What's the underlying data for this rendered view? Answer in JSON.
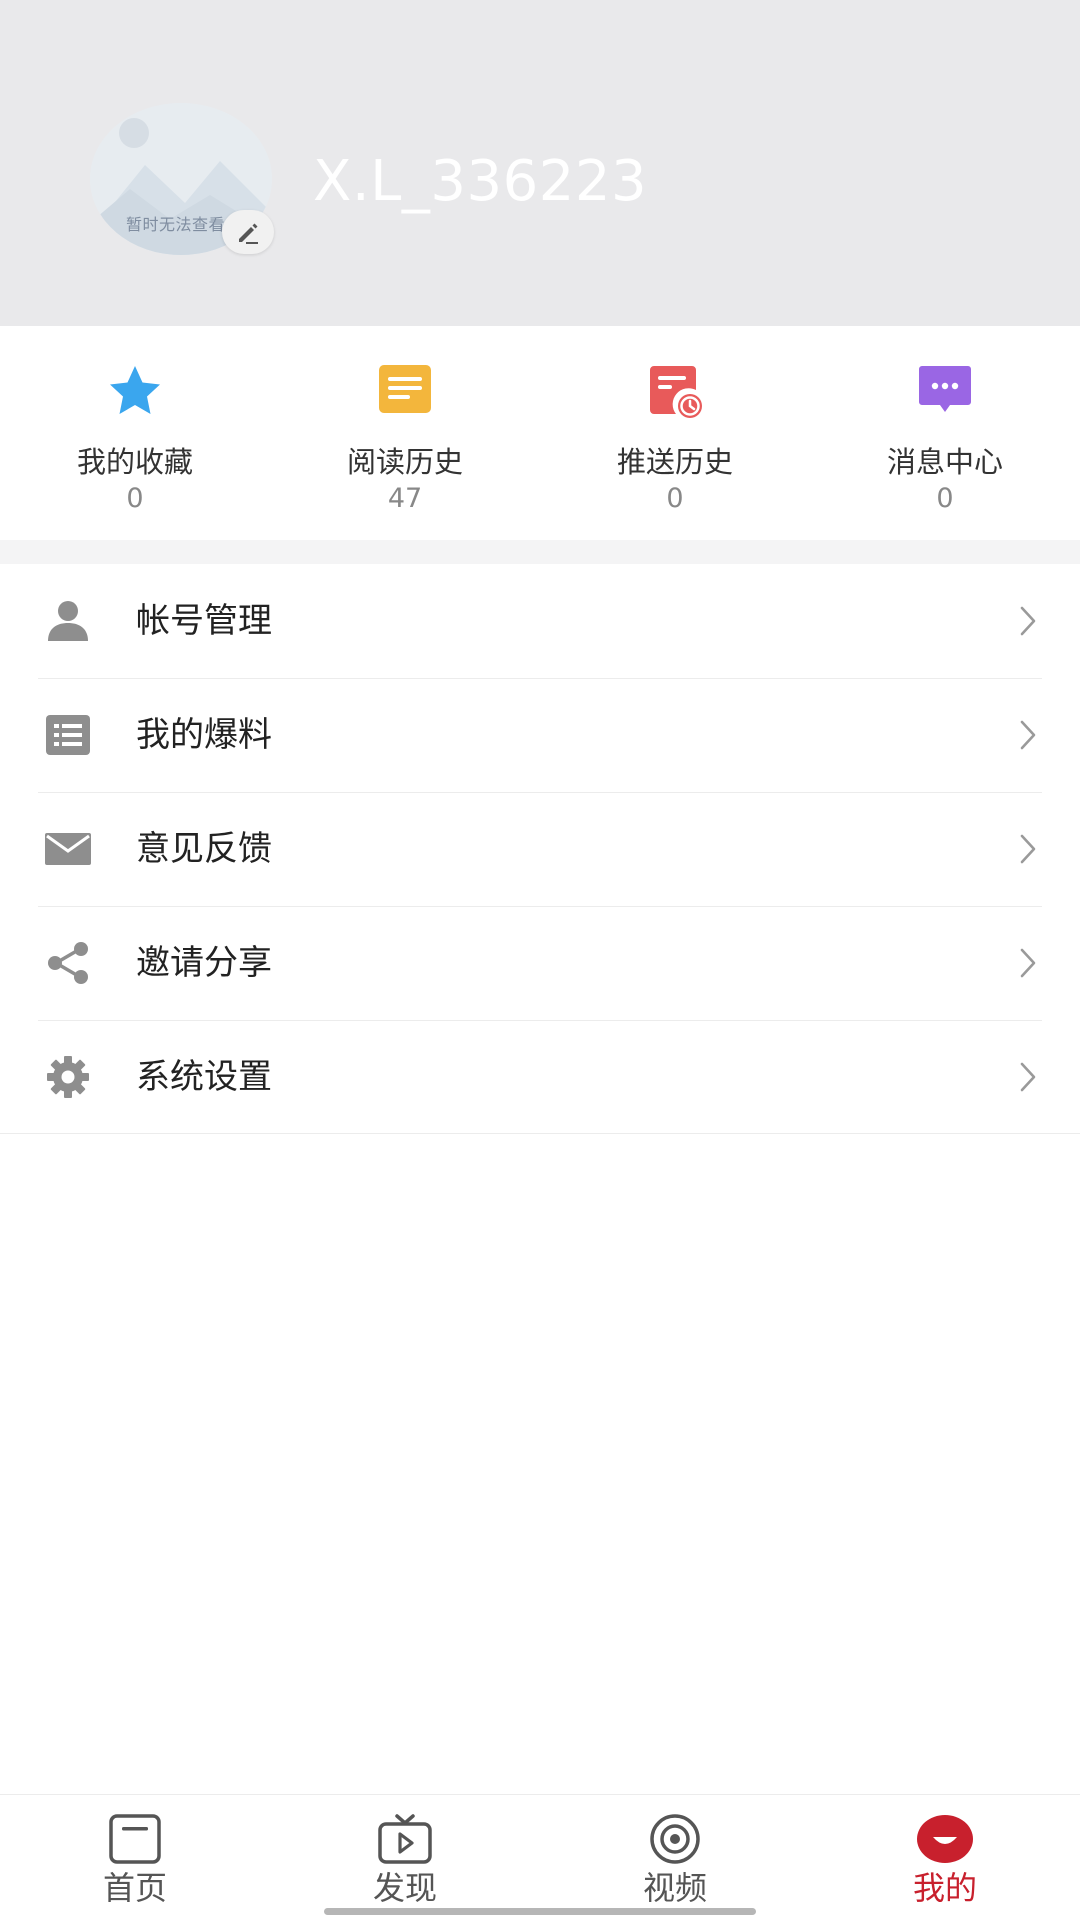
{
  "profile": {
    "username": "X.L_336223",
    "avatar_caption": "暂时无法查看"
  },
  "stats": [
    {
      "label": "我的收藏",
      "count": "0",
      "icon": "star-icon",
      "color": "#3aa6ee"
    },
    {
      "label": "阅读历史",
      "count": "47",
      "icon": "document-lines-icon",
      "color": "#f3b63c"
    },
    {
      "label": "推送历史",
      "count": "0",
      "icon": "push-history-icon",
      "color": "#e85a5a"
    },
    {
      "label": "消息中心",
      "count": "0",
      "icon": "chat-bubble-icon",
      "color": "#9a66e4"
    }
  ],
  "menu": [
    {
      "label": "帐号管理",
      "icon": "user-icon"
    },
    {
      "label": "我的爆料",
      "icon": "list-icon"
    },
    {
      "label": "意见反馈",
      "icon": "mail-icon"
    },
    {
      "label": "邀请分享",
      "icon": "share-icon"
    },
    {
      "label": "系统设置",
      "icon": "gear-icon"
    }
  ],
  "tabs": [
    {
      "label": "首页",
      "icon": "home-icon",
      "active": false
    },
    {
      "label": "发现",
      "icon": "tv-play-icon",
      "active": false
    },
    {
      "label": "视频",
      "icon": "video-icon",
      "active": false
    },
    {
      "label": "我的",
      "icon": "profile-tab-icon",
      "active": true
    }
  ],
  "colors": {
    "accent": "#c8202d",
    "header_bg": "#e9e9eb",
    "icon_gray": "#8e8e8e"
  }
}
